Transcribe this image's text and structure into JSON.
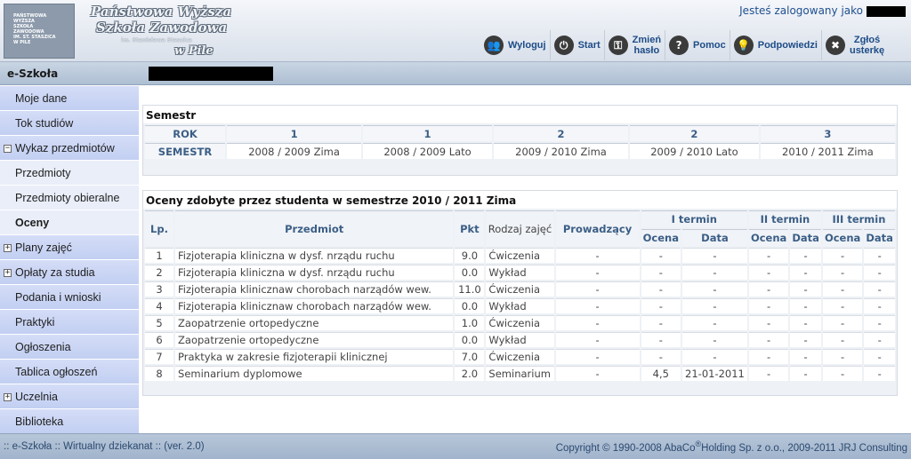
{
  "header": {
    "logo_lines": [
      "Państwowa",
      "Wyższa",
      "Szkoła",
      "Zawodowa",
      "im. St. Staszica",
      "w Pile"
    ],
    "school_name_line1": "Państwowa Wyższa",
    "school_name_line2": "Szkoła Zawodowa",
    "school_name_line3": "im. Stanisława Staszica",
    "school_name_line4": "w Pile",
    "login_text": "Jesteś zalogowany jako",
    "toolbar": [
      {
        "icon": "users-icon",
        "glyph": "👥",
        "label": "Wyloguj"
      },
      {
        "icon": "power-icon",
        "glyph": "⏻",
        "label": "Start"
      },
      {
        "icon": "key-icon",
        "glyph": "⚿",
        "label": "Zmień\nhasło"
      },
      {
        "icon": "help-icon",
        "glyph": "?",
        "label": "Pomoc"
      },
      {
        "icon": "lightbulb-icon",
        "glyph": "💡",
        "label": "Podpowiedzi"
      },
      {
        "icon": "tools-icon",
        "glyph": "✖",
        "label": "Zgłoś\nusterkę"
      }
    ]
  },
  "titlebar": {
    "app_name": "e-Szkoła"
  },
  "sidebar": {
    "items": [
      {
        "label": "Moje dane",
        "type": "normal"
      },
      {
        "label": "Tok studiów",
        "type": "normal"
      },
      {
        "label": "Wykaz przedmiotów",
        "type": "expanded"
      },
      {
        "label": "Przedmioty",
        "type": "sub"
      },
      {
        "label": "Przedmioty obieralne",
        "type": "sub"
      },
      {
        "label": "Oceny",
        "type": "sub-active"
      },
      {
        "label": "Plany zajęć",
        "type": "collapsed"
      },
      {
        "label": "Opłaty za studia",
        "type": "collapsed"
      },
      {
        "label": "Podania i wnioski",
        "type": "normal"
      },
      {
        "label": "Praktyki",
        "type": "normal"
      },
      {
        "label": "Ogłoszenia",
        "type": "normal"
      },
      {
        "label": "Tablica ogłoszeń",
        "type": "normal"
      },
      {
        "label": "Uczelnia",
        "type": "collapsed"
      },
      {
        "label": "Biblioteka",
        "type": "normal"
      }
    ]
  },
  "semester": {
    "title": "Semestr",
    "rok_label": "ROK",
    "semestr_label": "SEMESTR",
    "columns": [
      {
        "rok": "1",
        "semestr": "2008 / 2009 Zima"
      },
      {
        "rok": "1",
        "semestr": "2008 / 2009 Lato"
      },
      {
        "rok": "2",
        "semestr": "2009 / 2010 Zima"
      },
      {
        "rok": "2",
        "semestr": "2009 / 2010 Lato"
      },
      {
        "rok": "3",
        "semestr": "2010 / 2011 Zima"
      }
    ]
  },
  "grades": {
    "title": "Oceny zdobyte przez studenta w semestrze 2010 / 2011 Zima",
    "headers": {
      "lp": "Lp.",
      "przedmiot": "Przedmiot",
      "pkt": "Pkt",
      "rodzaj": "Rodzaj zajęć",
      "prowadzacy": "Prowadzący",
      "t1": "I termin",
      "t2": "II termin",
      "t3": "III termin",
      "ocena": "Ocena",
      "data": "Data"
    },
    "rows": [
      {
        "lp": "1",
        "przedmiot": "Fizjoterapia kliniczna w dysf. nrządu ruchu",
        "pkt": "9.0",
        "rodzaj": "Ćwiczenia",
        "prow": "-",
        "o1": "-",
        "d1": "-",
        "o2": "-",
        "d2": "-",
        "o3": "-",
        "d3": "-"
      },
      {
        "lp": "2",
        "przedmiot": "Fizjoterapia kliniczna w dysf. nrządu ruchu",
        "pkt": "0.0",
        "rodzaj": "Wykład",
        "prow": "-",
        "o1": "-",
        "d1": "-",
        "o2": "-",
        "d2": "-",
        "o3": "-",
        "d3": "-"
      },
      {
        "lp": "3",
        "przedmiot": "Fizjoterapia klinicznaw chorobach narządów wew.",
        "pkt": "11.0",
        "rodzaj": "Ćwiczenia",
        "prow": "-",
        "o1": "-",
        "d1": "-",
        "o2": "-",
        "d2": "-",
        "o3": "-",
        "d3": "-"
      },
      {
        "lp": "4",
        "przedmiot": "Fizjoterapia klinicznaw chorobach narządów wew.",
        "pkt": "0.0",
        "rodzaj": "Wykład",
        "prow": "-",
        "o1": "-",
        "d1": "-",
        "o2": "-",
        "d2": "-",
        "o3": "-",
        "d3": "-"
      },
      {
        "lp": "5",
        "przedmiot": "Zaopatrzenie ortopedyczne",
        "pkt": "1.0",
        "rodzaj": "Ćwiczenia",
        "prow": "-",
        "o1": "-",
        "d1": "-",
        "o2": "-",
        "d2": "-",
        "o3": "-",
        "d3": "-"
      },
      {
        "lp": "6",
        "przedmiot": "Zaopatrzenie ortopedyczne",
        "pkt": "0.0",
        "rodzaj": "Wykład",
        "prow": "-",
        "o1": "-",
        "d1": "-",
        "o2": "-",
        "d2": "-",
        "o3": "-",
        "d3": "-"
      },
      {
        "lp": "7",
        "przedmiot": "Praktyka w zakresie fizjoterapii klinicznej",
        "pkt": "7.0",
        "rodzaj": "Ćwiczenia",
        "prow": "-",
        "o1": "-",
        "d1": "-",
        "o2": "-",
        "d2": "-",
        "o3": "-",
        "d3": "-"
      },
      {
        "lp": "8",
        "przedmiot": "Seminarium dyplomowe",
        "pkt": "2.0",
        "rodzaj": "Seminarium",
        "prow": "-",
        "o1": "4,5",
        "d1": "21-01-2011",
        "o2": "-",
        "d2": "-",
        "o3": "-",
        "d3": "-"
      }
    ]
  },
  "footer": {
    "left": ":: e-Szkoła :: Wirtualny dziekanat :: (ver. 2.0)",
    "right_pre": "Copyright © 1990-2008 AbaCo",
    "right_reg": "®",
    "right_post": "Holding Sp. z o.o., 2009-2011 JRJ Consulting"
  },
  "colors": {
    "accent_text": "#1d4c87",
    "sidebar_bg": "#c2cff2",
    "table_header_text": "#3b5e86"
  }
}
